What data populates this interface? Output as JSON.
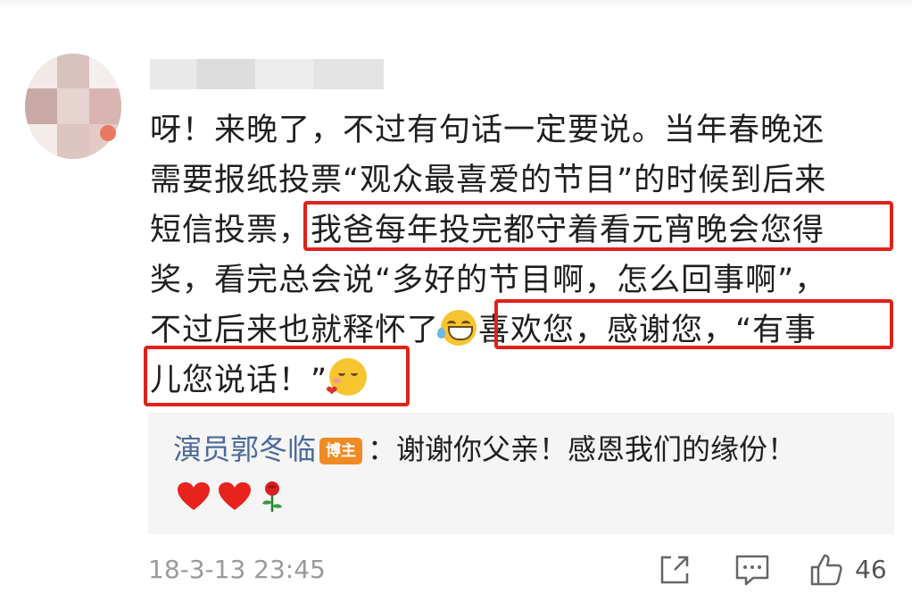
{
  "comment": {
    "lines": [
      "呀！来晚了，不过有句话一定要说。当年春晚还",
      "需要报纸投票“观众最喜爱的节目”的时候到后来",
      "短信投票，",
      "我爸每年投完都守着看元宵晚会您得",
      "奖，看完总会说“多好的节目啊，怎么回事啊”，",
      "不过后来也就释怀了",
      "喜欢您，感谢您，“有事",
      "儿您说话！”"
    ]
  },
  "reply": {
    "author": "演员郭冬临",
    "badge": "博主",
    "text": "：谢谢你父亲！感恩我们的缘份！"
  },
  "footer": {
    "timestamp": "18-3-13 23:45",
    "like_count": "46"
  },
  "icons": {
    "laugh": "laughing-tears-emoji",
    "love": "love-heart-emoji",
    "heart": "red-heart-emoji",
    "rose": "rose-emoji",
    "share": "share-icon",
    "comment": "comment-icon",
    "like": "thumbs-up-icon"
  },
  "colors": {
    "highlight": "#e0211b",
    "author_link": "#4c6a9a",
    "badge": "#f08a24",
    "meta": "#9a9a9a"
  }
}
